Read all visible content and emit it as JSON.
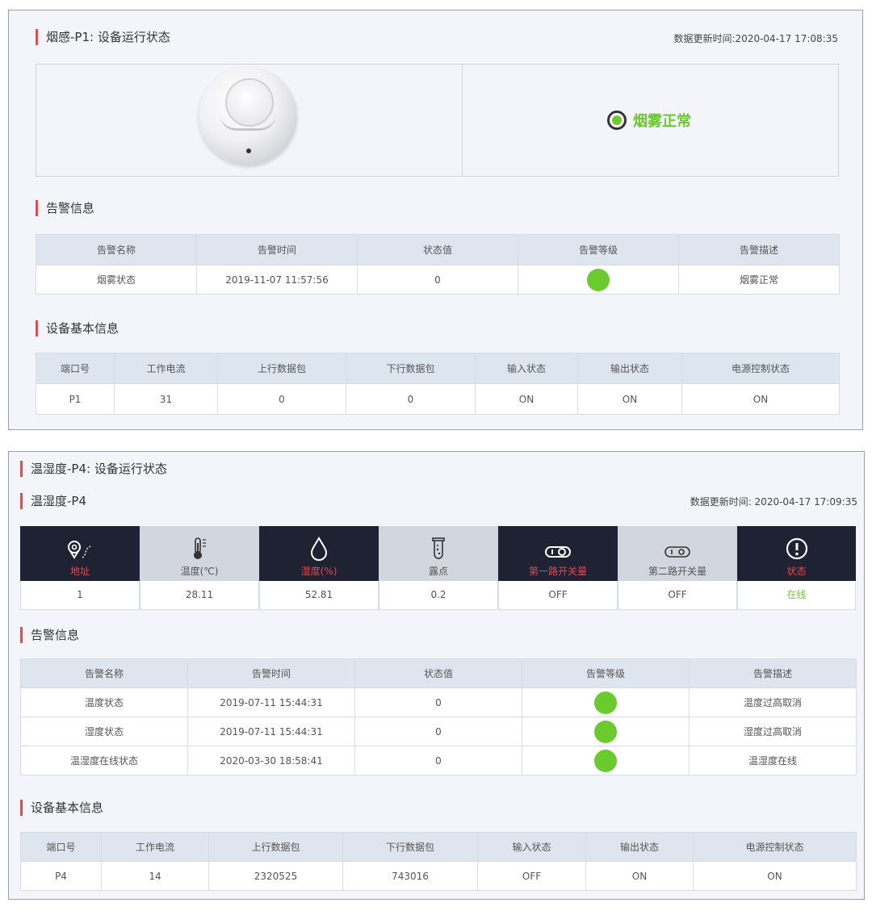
{
  "panel1": {
    "title": "烟感-P1: 设备运行状态",
    "update_time": "数据更新时间:2020-04-17 17:08:35",
    "status_text": "烟雾正常",
    "alarm_section_title": "告警信息",
    "alarm_headers": [
      "告警名称",
      "告警时间",
      "状态值",
      "告警等级",
      "告警描述"
    ],
    "alarm_rows": [
      {
        "name": "烟雾状态",
        "time": "2019-11-07 11:57:56",
        "value": "0",
        "desc": "烟雾正常"
      }
    ],
    "info_section_title": "设备基本信息",
    "info_headers": [
      "端口号",
      "工作电流",
      "上行数据包",
      "下行数据包",
      "输入状态",
      "输出状态",
      "电源控制状态"
    ],
    "info_row": [
      "P1",
      "31",
      "0",
      "0",
      "ON",
      "ON",
      "ON"
    ]
  },
  "panel2": {
    "title": "温湿度-P4: 设备运行状态",
    "subtitle": "温湿度-P4",
    "update_time": "数据更新时间: 2020-04-17 17:09:35",
    "tiles": [
      {
        "label": "地址",
        "value": "1",
        "icon": "location-icon"
      },
      {
        "label": "温度(℃)",
        "value": "28.11",
        "icon": "thermometer-icon"
      },
      {
        "label": "湿度(%)",
        "value": "52.81",
        "icon": "water-drop-icon"
      },
      {
        "label": "露点",
        "value": "0.2",
        "icon": "test-tube-icon"
      },
      {
        "label": "第一路开关量",
        "value": "OFF",
        "icon": "toggle-icon"
      },
      {
        "label": "第二路开关量",
        "value": "OFF",
        "icon": "toggle-icon"
      },
      {
        "label": "状态",
        "value": "在线",
        "icon": "alert-circle-icon"
      }
    ],
    "alarm_section_title": "告警信息",
    "alarm_headers": [
      "告警名称",
      "告警时间",
      "状态值",
      "告警等级",
      "告警描述"
    ],
    "alarm_rows": [
      {
        "name": "温度状态",
        "time": "2019-07-11 15:44:31",
        "value": "0",
        "desc": "温度过高取消"
      },
      {
        "name": "湿度状态",
        "time": "2019-07-11 15:44:31",
        "value": "0",
        "desc": "湿度过高取消"
      },
      {
        "name": "温湿度在线状态",
        "time": "2020-03-30 18:58:41",
        "value": "0",
        "desc": "温湿度在线"
      }
    ],
    "info_section_title": "设备基本信息",
    "info_headers": [
      "端口号",
      "工作电流",
      "上行数据包",
      "下行数据包",
      "输入状态",
      "输出状态",
      "电源控制状态"
    ],
    "info_row": [
      "P4",
      "14",
      "2320525",
      "743016",
      "OFF",
      "ON",
      "ON"
    ]
  },
  "colors": {
    "accent_bar": "#e84a4a",
    "ok_green": "#6bcb2e",
    "dark_tile": "#1e2233"
  }
}
